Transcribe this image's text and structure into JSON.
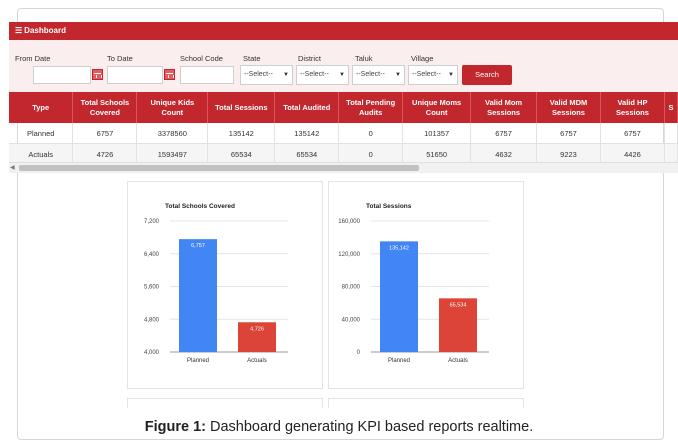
{
  "header": {
    "title": "Dashboard",
    "menu_icon": "menu-icon"
  },
  "filters": {
    "from_date_label": "From Date",
    "to_date_label": "To Date",
    "school_code_label": "School Code",
    "state_label": "State",
    "state_value": "--Select--",
    "district_label": "District",
    "district_value": "--Select--",
    "taluk_label": "Taluk",
    "taluk_value": "--Select--",
    "village_label": "Village",
    "village_value": "--Select--",
    "search_label": "Search"
  },
  "table": {
    "columns": [
      "Type",
      "Total Schools Covered",
      "Unique Kids Count",
      "Total Sessions",
      "Total Audited",
      "Total Pending Audits",
      "Unique Moms Count",
      "Valid Mom Sessions",
      "Valid MDM Sessions",
      "Valid HP Sessions",
      "S"
    ],
    "rows": [
      [
        "Planned",
        "6757",
        "3378560",
        "135142",
        "135142",
        "0",
        "101357",
        "6757",
        "6757",
        "6757",
        ""
      ],
      [
        "Actuals",
        "4726",
        "1593497",
        "65534",
        "65534",
        "0",
        "51650",
        "4632",
        "9223",
        "4426",
        ""
      ]
    ]
  },
  "chart_data": [
    {
      "type": "bar",
      "title": "Total Schools Covered",
      "categories": [
        "Planned",
        "Actuals"
      ],
      "values": [
        6757,
        4726
      ],
      "value_labels": [
        "6,757",
        "4,726"
      ],
      "colors": [
        "#4285f4",
        "#db4437"
      ],
      "ylim": [
        4000,
        7200
      ],
      "yticks": [
        4000,
        4800,
        5600,
        6400,
        7200
      ],
      "ytick_labels": [
        "4,000",
        "4,800",
        "5,600",
        "6,400",
        "7,200"
      ],
      "grid": true
    },
    {
      "type": "bar",
      "title": "Total Sessions",
      "categories": [
        "Planned",
        "Actuals"
      ],
      "values": [
        135142,
        65534
      ],
      "value_labels": [
        "135,142",
        "65,534"
      ],
      "colors": [
        "#4285f4",
        "#db4437"
      ],
      "ylim": [
        0,
        160000
      ],
      "yticks": [
        0,
        40000,
        80000,
        120000,
        160000
      ],
      "ytick_labels": [
        "0",
        "40,000",
        "80,000",
        "120,000",
        "160,000"
      ],
      "grid": true
    }
  ],
  "caption": {
    "label": "Figure 1:",
    "text": " Dashboard generating KPI based reports realtime."
  }
}
